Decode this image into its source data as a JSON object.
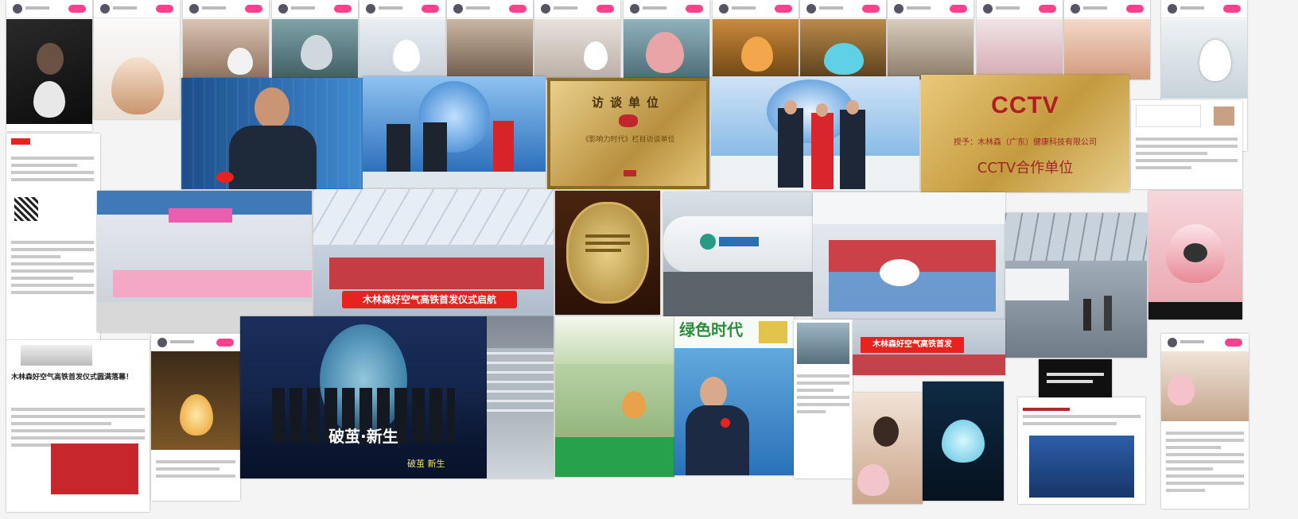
{
  "collage": {
    "cctv_plaque": {
      "logo": "CCTV",
      "recipient": "授予：木林森（广东）健康科技有限公司",
      "title": "CCTV合作单位"
    },
    "interview_plaque": {
      "title": "访谈单位",
      "body": "《影响力时代》栏目访谈单位"
    },
    "banners": {
      "highspeed_rail": "木林森好空气高铁首发仪式启航",
      "small_banner": "木林森好空气高铁首发"
    },
    "green_times": {
      "title": "绿色时代"
    },
    "launch_event": {
      "slogan": "破茧·新生",
      "small_slogan": "破茧 新生"
    },
    "article": {
      "headline": "木林森好空气高铁首发仪式圆满落幕！"
    },
    "accent_color": "#e8221e",
    "gold_color": "#c9a04a"
  }
}
